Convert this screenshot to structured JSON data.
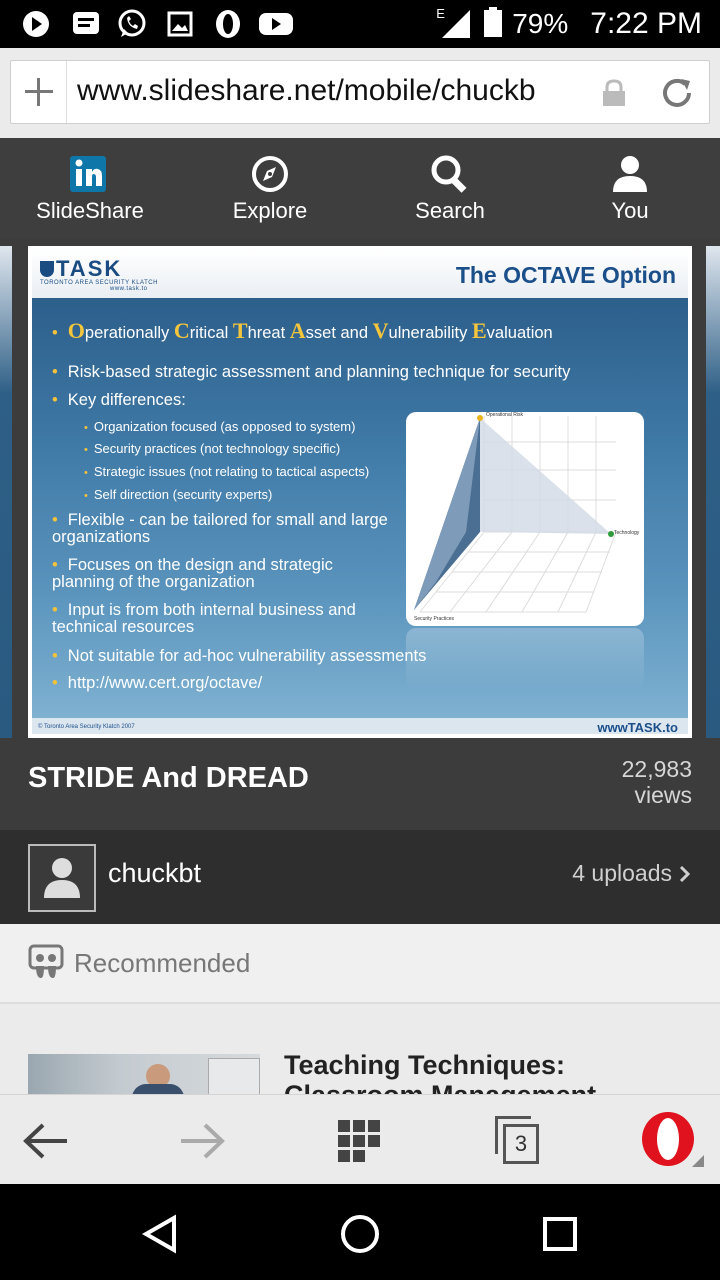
{
  "status_bar": {
    "network": "E",
    "battery_percent": "79%",
    "time": "7:22 PM"
  },
  "browser": {
    "url": "www.slideshare.net/mobile/chuckb",
    "tab_count": "3"
  },
  "nav": {
    "items": [
      {
        "label": "SlideShare"
      },
      {
        "label": "Explore"
      },
      {
        "label": "Search"
      },
      {
        "label": "You"
      }
    ]
  },
  "slide": {
    "logo": "TASK",
    "logo_sub": "TORONTO AREA SECURITY KLATCH",
    "logo_url": "www.task.to",
    "title": "The OCTAVE Option",
    "acronym": [
      {
        "cap": "O",
        "rest": "perationally "
      },
      {
        "cap": "C",
        "rest": "ritical "
      },
      {
        "cap": "T",
        "rest": "hreat "
      },
      {
        "cap": "A",
        "rest": "sset and "
      },
      {
        "cap": "V",
        "rest": "ulnerability "
      },
      {
        "cap": "E",
        "rest": "valuation"
      }
    ],
    "bullets": [
      "Risk-based strategic assessment and planning technique for security",
      "Key differences:"
    ],
    "sub_bullets": [
      "Organization focused (as opposed to system)",
      "Security practices (not technology specific)",
      "Strategic issues (not relating to tactical aspects)",
      "Self direction (security experts)"
    ],
    "bullets_after": [
      "Flexible - can be tailored for small and large organizations",
      "Focuses on the design and strategic planning of the organization",
      "Input is from both internal business and technical resources",
      "Not suitable for ad-hoc vulnerability assessments",
      "http://www.cert.org/octave/"
    ],
    "chart_labels": {
      "top": "Operational Risk",
      "right": "Technology",
      "bottom": "Security Practices"
    },
    "footer_left": "© Toronto Area Security Klatch 2007",
    "footer_right": "wwwTASK.to"
  },
  "document": {
    "title": "STRIDE And DREAD",
    "views_count": "22,983",
    "views_label": "views"
  },
  "author": {
    "name": "chuckbt",
    "uploads": "4 uploads"
  },
  "recommended": {
    "label": "Recommended",
    "items": [
      {
        "title": "Teaching Techniques: Classroom Management"
      }
    ]
  },
  "colors": {
    "nav_bg": "#3e3e3e",
    "linkedin_blue": "#0e76a8",
    "opera_red": "#e0121d",
    "slide_title": "#1b4f8a",
    "slide_accent": "#f5c63c"
  }
}
